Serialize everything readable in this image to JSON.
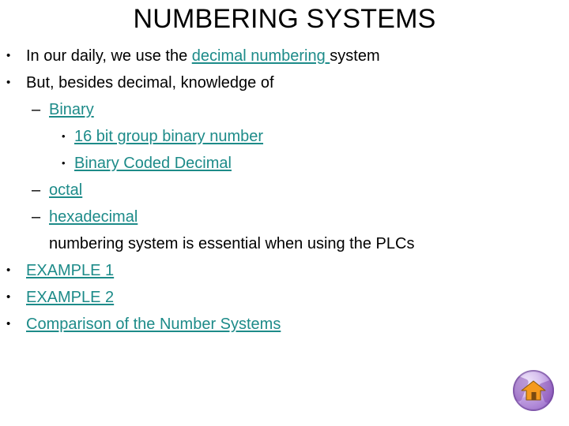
{
  "slide": {
    "title": "NUMBERING SYSTEMS",
    "background_color": "#ffffff",
    "title_color": "#000000",
    "link_color": "#1d8b89",
    "text_color": "#000000"
  },
  "content": {
    "lines": [
      {
        "level": 1,
        "bullet": "•",
        "segments": [
          {
            "text": "In our daily, we use the ",
            "link": false
          },
          {
            "text": "decimal numbering ",
            "link": true
          },
          {
            "text": "system",
            "link": false
          }
        ]
      },
      {
        "level": 1,
        "bullet": "•",
        "segments": [
          {
            "text": "But, besides decimal, knowledge of",
            "link": false
          }
        ]
      },
      {
        "level": 2,
        "bullet": "–",
        "segments": [
          {
            "text": "Binary",
            "link": true
          }
        ]
      },
      {
        "level": 3,
        "bullet": "•",
        "segments": [
          {
            "text": "16 bit group binary number",
            "link": true
          }
        ]
      },
      {
        "level": 3,
        "bullet": "•",
        "segments": [
          {
            "text": "Binary Coded Decimal",
            "link": true
          }
        ]
      },
      {
        "level": 2,
        "bullet": "–",
        "segments": [
          {
            "text": "octal",
            "link": true
          }
        ]
      },
      {
        "level": 2,
        "bullet": "–",
        "segments": [
          {
            "text": "hexadecimal",
            "link": true
          }
        ]
      },
      {
        "level": 2,
        "bullet": "",
        "segments": [
          {
            "text": "numbering system is essential when using the PLCs",
            "link": false
          }
        ]
      },
      {
        "level": 1,
        "bullet": "•",
        "segments": [
          {
            "text": "EXAMPLE 1",
            "link": true
          }
        ]
      },
      {
        "level": 1,
        "bullet": "•",
        "segments": [
          {
            "text": "EXAMPLE 2",
            "link": true
          }
        ]
      },
      {
        "level": 1,
        "bullet": "•",
        "segments": [
          {
            "text": "Comparison of the Number Systems",
            "link": true
          }
        ]
      }
    ]
  },
  "home_button": {
    "icon": "home-icon",
    "house_color": "#f59a1e",
    "door_color": "#7a4a10",
    "circle_color": "#b893dd"
  }
}
